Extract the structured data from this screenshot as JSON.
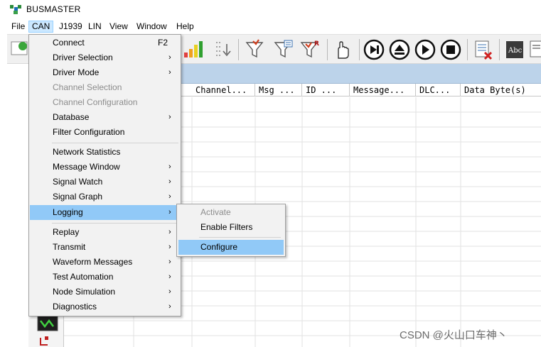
{
  "app": {
    "title": "BUSMASTER"
  },
  "menubar": {
    "items": [
      {
        "label": "File"
      },
      {
        "label": "CAN"
      },
      {
        "label": "J1939"
      },
      {
        "label": "LIN"
      },
      {
        "label": "View"
      },
      {
        "label": "Window"
      },
      {
        "label": "Help"
      }
    ]
  },
  "message_window": {
    "columns": [
      "...",
      "Channel...",
      "Msg ...",
      "ID ...",
      "Message...",
      "DLC...",
      "Data Byte(s)"
    ]
  },
  "can_menu": {
    "connect": {
      "label": "Connect",
      "shortcut": "F2"
    },
    "driver_selection": {
      "label": "Driver Selection"
    },
    "driver_mode": {
      "label": "Driver Mode"
    },
    "channel_selection": {
      "label": "Channel Selection"
    },
    "channel_configuration": {
      "label": "Channel Configuration"
    },
    "database": {
      "label": "Database"
    },
    "filter_configuration": {
      "label": "Filter Configuration"
    },
    "network_statistics": {
      "label": "Network Statistics"
    },
    "message_window": {
      "label": "Message Window"
    },
    "signal_watch": {
      "label": "Signal Watch"
    },
    "signal_graph": {
      "label": "Signal Graph"
    },
    "logging": {
      "label": "Logging"
    },
    "replay": {
      "label": "Replay"
    },
    "transmit": {
      "label": "Transmit"
    },
    "waveform_messages": {
      "label": "Waveform Messages"
    },
    "test_automation": {
      "label": "Test Automation"
    },
    "node_simulation": {
      "label": "Node Simulation"
    },
    "diagnostics": {
      "label": "Diagnostics"
    }
  },
  "logging_submenu": {
    "activate": {
      "label": "Activate"
    },
    "enable_filters": {
      "label": "Enable Filters"
    },
    "configure": {
      "label": "Configure"
    }
  },
  "submenu_arrow": "›",
  "watermark": "CSDN @火山口车神丶",
  "colors": {
    "highlight": "#91c9f7",
    "menu_bg": "#f2f2f2",
    "active_menu": "#cce8ff"
  }
}
